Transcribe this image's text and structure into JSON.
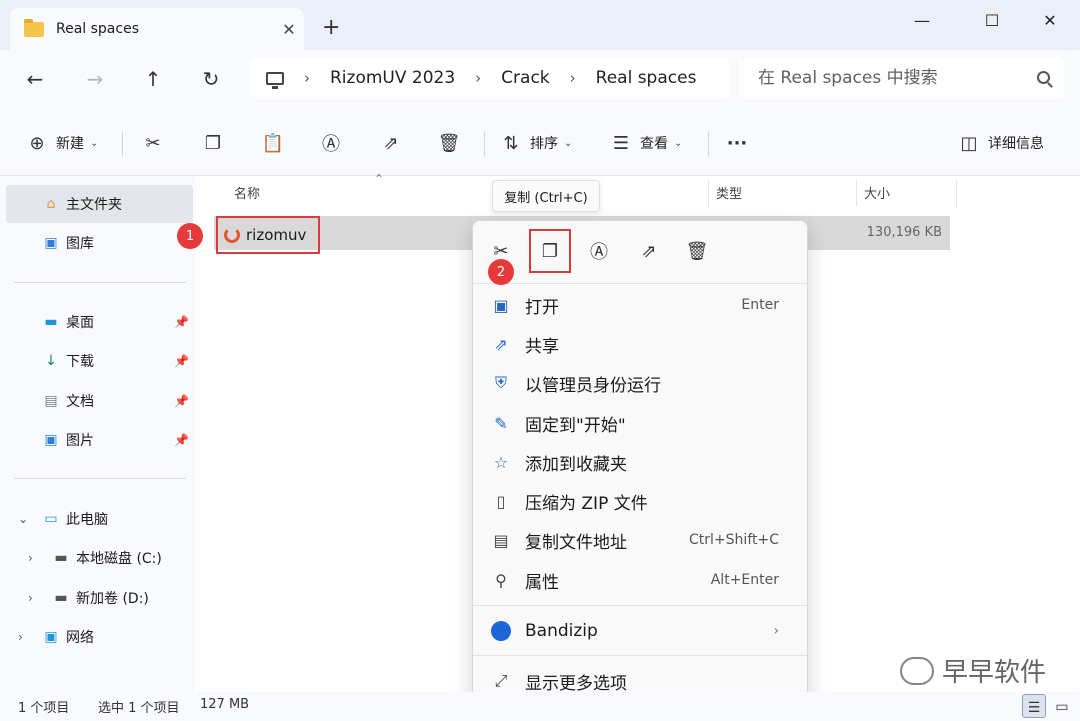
{
  "window": {
    "tab_title": "Real spaces",
    "tab_close": "✕",
    "new_tab": "+",
    "minimize": "—",
    "maximize": "☐",
    "close": "✕"
  },
  "nav": {
    "back": "←",
    "forward": "→",
    "up": "↑",
    "refresh": "↻"
  },
  "breadcrumb": {
    "items": [
      "RizomUV 2023",
      "Crack",
      "Real spaces"
    ],
    "separator": "›"
  },
  "search": {
    "placeholder": "在 Real spaces 中搜索"
  },
  "toolbar": {
    "new_label": "新建",
    "sort_label": "排序",
    "view_label": "查看",
    "more": "···",
    "details_label": "详细信息"
  },
  "sidebar": {
    "items": [
      {
        "label": "主文件夹",
        "icon": "home-icon"
      },
      {
        "label": "图库",
        "icon": "gallery-icon"
      },
      {
        "label": "桌面",
        "icon": "desktop-icon"
      },
      {
        "label": "下载",
        "icon": "download-icon"
      },
      {
        "label": "文档",
        "icon": "document-icon"
      },
      {
        "label": "图片",
        "icon": "pictures-icon"
      },
      {
        "label": "此电脑",
        "icon": "computer-icon"
      },
      {
        "label": "本地磁盘 (C:)",
        "icon": "drive-icon"
      },
      {
        "label": "新加卷 (D:)",
        "icon": "drive-icon"
      },
      {
        "label": "网络",
        "icon": "network-icon"
      }
    ]
  },
  "columns": {
    "name": "名称",
    "type": "类型",
    "size": "大小"
  },
  "file": {
    "name": "rizomuv",
    "size": "130,196 KB"
  },
  "badges": {
    "step1": "1",
    "step2": "2"
  },
  "tooltip": "复制 (Ctrl+C)",
  "context_menu": {
    "items": [
      {
        "label": "打开",
        "shortcut": "Enter",
        "icon": "open-icon"
      },
      {
        "label": "共享",
        "shortcut": "",
        "icon": "share-icon"
      },
      {
        "label": "以管理员身份运行",
        "shortcut": "",
        "icon": "shield-icon"
      },
      {
        "label": "固定到\"开始\"",
        "shortcut": "",
        "icon": "pin-icon"
      },
      {
        "label": "添加到收藏夹",
        "shortcut": "",
        "icon": "star-icon"
      },
      {
        "label": "压缩为 ZIP 文件",
        "shortcut": "",
        "icon": "zip-icon"
      },
      {
        "label": "复制文件地址",
        "shortcut": "Ctrl+Shift+C",
        "icon": "copy-path-icon"
      },
      {
        "label": "属性",
        "shortcut": "Alt+Enter",
        "icon": "wrench-icon"
      },
      {
        "label": "Bandizip",
        "shortcut": "",
        "icon": "bandizip-icon"
      },
      {
        "label": "显示更多选项",
        "shortcut": "",
        "icon": "more-options-icon"
      }
    ]
  },
  "status": {
    "count": "1 个项目",
    "selected": "选中 1 个项目",
    "selected_size": "127 MB"
  },
  "watermark": "早早软件"
}
